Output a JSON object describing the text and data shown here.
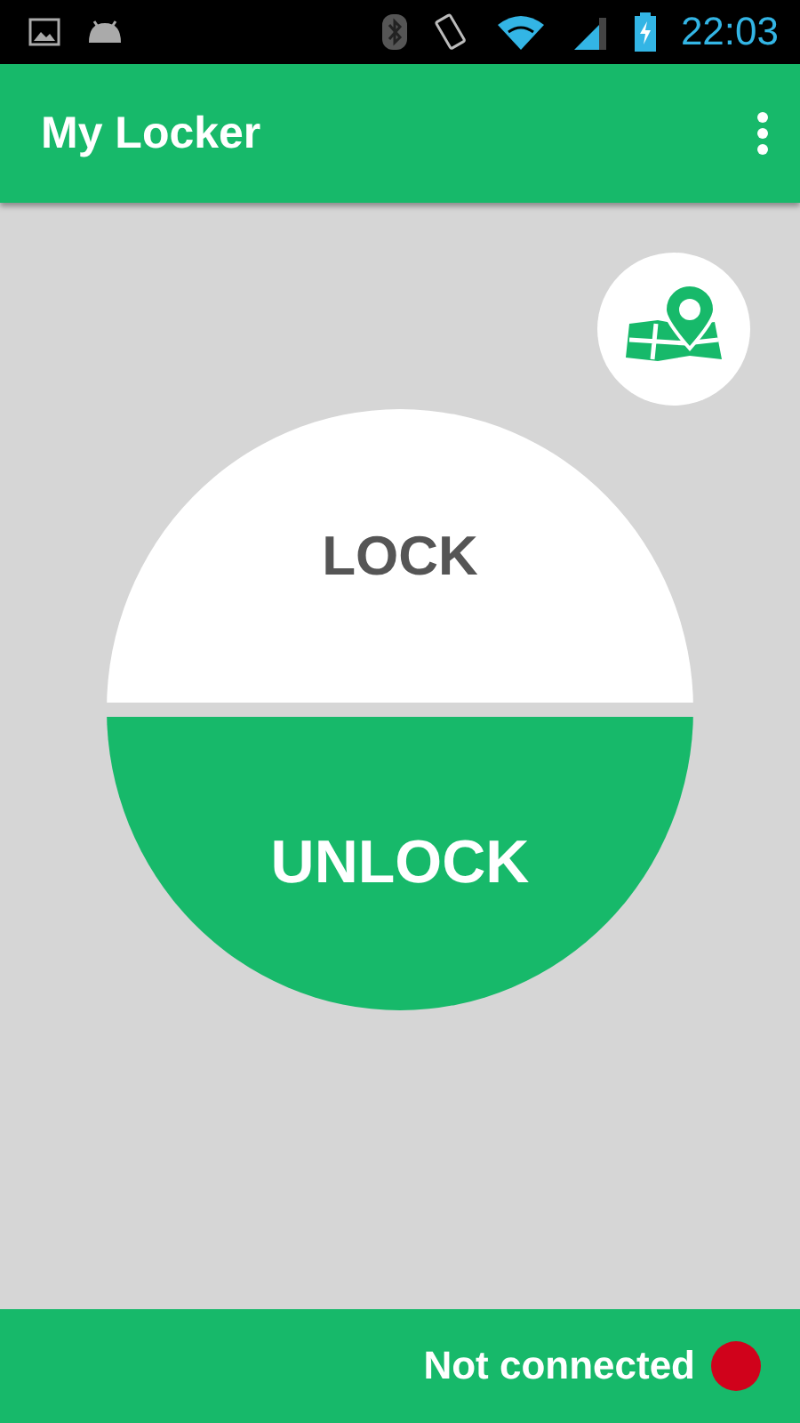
{
  "status_bar": {
    "time": "22:03"
  },
  "app_bar": {
    "title": "My Locker"
  },
  "lock_control": {
    "lock_label": "LOCK",
    "unlock_label": "UNLOCK"
  },
  "connection": {
    "label": "Not connected",
    "connected": false
  }
}
